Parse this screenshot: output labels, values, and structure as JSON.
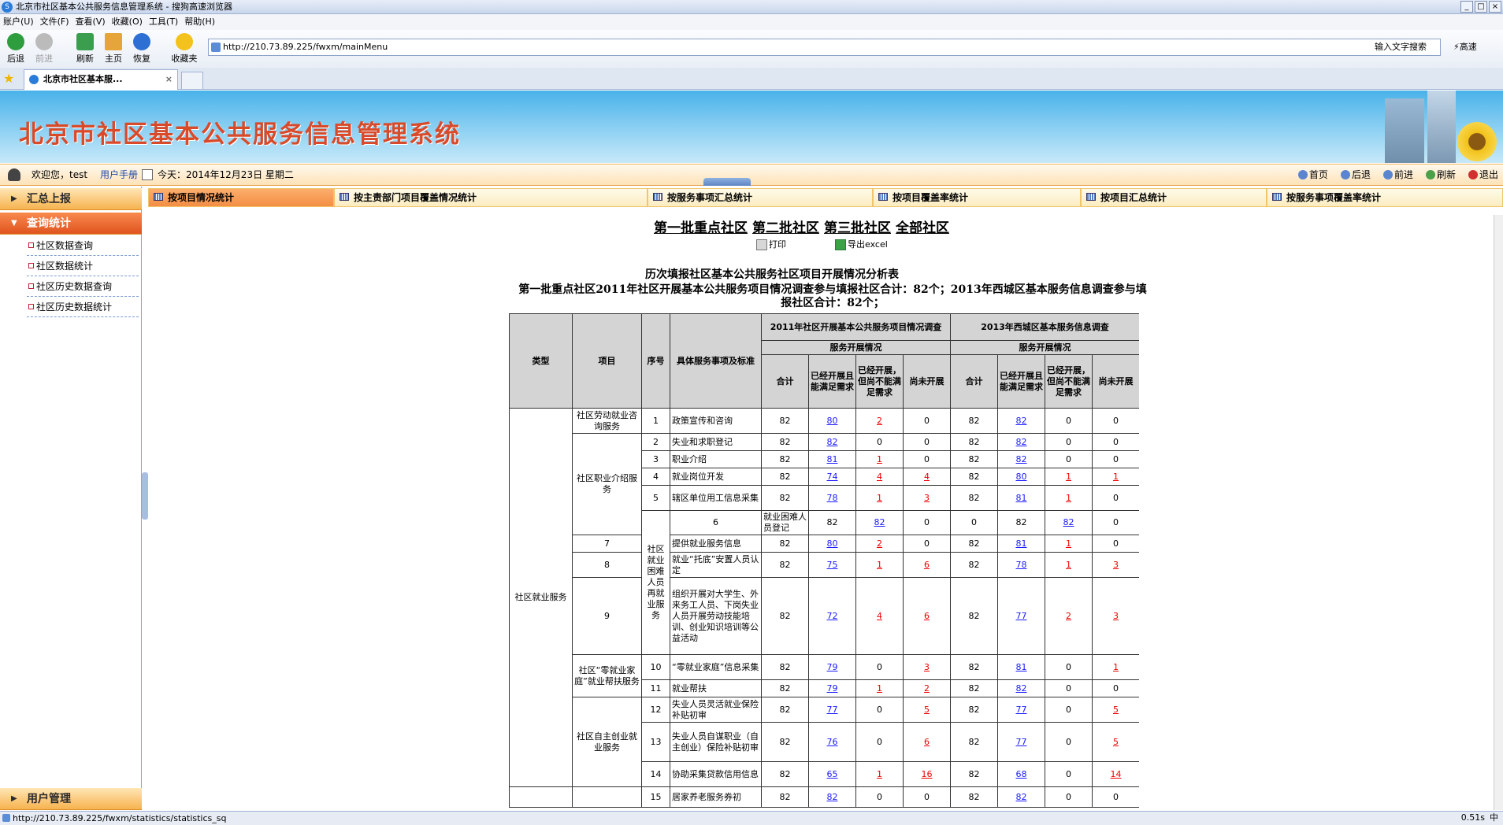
{
  "window": {
    "title": "北京市社区基本公共服务信息管理系统 - 搜狗高速浏览器"
  },
  "menu": [
    "账户(U)",
    "文件(F)",
    "查看(V)",
    "收藏(O)",
    "工具(T)",
    "帮助(H)"
  ],
  "toolbar": {
    "back": "后退",
    "forward": "前进",
    "refresh": "刷新",
    "home": "主页",
    "restore": "恢复",
    "favorites": "收藏夹",
    "fast": "高速"
  },
  "address": {
    "url": "http://210.73.89.225/fwxm/mainMenu",
    "search_placeholder": "输入文字搜索"
  },
  "browser_tab": {
    "label": "北京市社区基本服..."
  },
  "banner": {
    "title": "北京市社区基本公共服务信息管理系统"
  },
  "userbar": {
    "welcome": "欢迎您，test",
    "manual": "用户手册",
    "today": "今天：2014年12月23日  星期二"
  },
  "topnav": [
    "首页",
    "后退",
    "前进",
    "刷新",
    "退出"
  ],
  "sidebar": {
    "sec1": "汇总上报",
    "sec2": "查询统计",
    "items": [
      "社区数据查询",
      "社区数据统计",
      "社区历史数据查询",
      "社区历史数据统计"
    ],
    "sec3": "用户管理"
  },
  "content_tabs": [
    "按项目情况统计",
    "按主责部门项目覆盖情况统计",
    "按服务事项汇总统计",
    "按项目覆盖率统计",
    "按项目汇总统计",
    "按服务事项覆盖率统计"
  ],
  "batch_links": [
    "第一批重点社区",
    "第二批社区",
    "第三批社区",
    "全部社区"
  ],
  "actions": {
    "print": "打印",
    "export": "导出excel"
  },
  "report": {
    "title": "历次填报社区基本公共服务社区项目开展情况分析表",
    "subtitle": "第一批重点社区2011年社区开展基本公共服务项目情况调查参与填报社区合计：82个；2013年西城区基本服务信息调查参与填报社区合计：82个；",
    "headers": {
      "type": "类型",
      "project": "项目",
      "no": "序号",
      "detail": "具体服务事项及标准",
      "survey2011": "2011年社区开展基本公共服务项目情况调查",
      "survey2013": "2013年西城区基本服务信息调查",
      "service": "服务开展情况",
      "total": "合计",
      "met": "已经开展且能满足需求",
      "notmet": "已经开展，但尚不能满足需求",
      "none": "尚未开展"
    },
    "type1": "社区就业服务",
    "groups": [
      "社区劳动就业咨询服务",
      "社区职业介绍服务",
      "社区就业困难人员再就业服务",
      "社区“零就业家庭”就业帮扶服务",
      "社区自主创业就业服务"
    ],
    "rows": [
      {
        "no": "1",
        "item": "政策宣传和咨询",
        "a": "82",
        "b": "80",
        "c": "2",
        "d": "0",
        "e": "82",
        "f": "82",
        "g": "0",
        "h": "0"
      },
      {
        "no": "2",
        "item": "失业和求职登记",
        "a": "82",
        "b": "82",
        "c": "0",
        "d": "0",
        "e": "82",
        "f": "82",
        "g": "0",
        "h": "0"
      },
      {
        "no": "3",
        "item": "职业介绍",
        "a": "82",
        "b": "81",
        "c": "1",
        "d": "0",
        "e": "82",
        "f": "82",
        "g": "0",
        "h": "0"
      },
      {
        "no": "4",
        "item": "就业岗位开发",
        "a": "82",
        "b": "74",
        "c": "4",
        "d": "4",
        "e": "82",
        "f": "80",
        "g": "1",
        "h": "1"
      },
      {
        "no": "5",
        "item": "辖区单位用工信息采集",
        "a": "82",
        "b": "78",
        "c": "1",
        "d": "3",
        "e": "82",
        "f": "81",
        "g": "1",
        "h": "0"
      },
      {
        "no": "6",
        "item": "就业困难人员登记",
        "a": "82",
        "b": "82",
        "c": "0",
        "d": "0",
        "e": "82",
        "f": "82",
        "g": "0",
        "h": "0"
      },
      {
        "no": "7",
        "item": "提供就业服务信息",
        "a": "82",
        "b": "80",
        "c": "2",
        "d": "0",
        "e": "82",
        "f": "81",
        "g": "1",
        "h": "0"
      },
      {
        "no": "8",
        "item": "就业“托底”安置人员认定",
        "a": "82",
        "b": "75",
        "c": "1",
        "d": "6",
        "e": "82",
        "f": "78",
        "g": "1",
        "h": "3"
      },
      {
        "no": "9",
        "item": "组织开展对大学生、外来务工人员、下岗失业人员开展劳动技能培训、创业知识培训等公益活动",
        "a": "82",
        "b": "72",
        "c": "4",
        "d": "6",
        "e": "82",
        "f": "77",
        "g": "2",
        "h": "3"
      },
      {
        "no": "10",
        "item": "“零就业家庭”信息采集",
        "a": "82",
        "b": "79",
        "c": "0",
        "d": "3",
        "e": "82",
        "f": "81",
        "g": "0",
        "h": "1"
      },
      {
        "no": "11",
        "item": "就业帮扶",
        "a": "82",
        "b": "79",
        "c": "1",
        "d": "2",
        "e": "82",
        "f": "82",
        "g": "0",
        "h": "0"
      },
      {
        "no": "12",
        "item": "失业人员灵活就业保险补贴初审",
        "a": "82",
        "b": "77",
        "c": "0",
        "d": "5",
        "e": "82",
        "f": "77",
        "g": "0",
        "h": "5"
      },
      {
        "no": "13",
        "item": "失业人员自谋职业（自主创业）保险补贴初审",
        "a": "82",
        "b": "76",
        "c": "0",
        "d": "6",
        "e": "82",
        "f": "77",
        "g": "0",
        "h": "5"
      },
      {
        "no": "14",
        "item": "协助采集贷款信用信息",
        "a": "82",
        "b": "65",
        "c": "1",
        "d": "16",
        "e": "82",
        "f": "68",
        "g": "0",
        "h": "14"
      },
      {
        "no": "15",
        "item": "居家养老服务券初",
        "a": "82",
        "b": "82",
        "c": "0",
        "d": "0",
        "e": "82",
        "f": "82",
        "g": "0",
        "h": "0"
      }
    ]
  },
  "status": {
    "url": "http://210.73.89.225/fwxm/statistics/statistics_sq",
    "time": "0.51s",
    "ime": "中"
  }
}
